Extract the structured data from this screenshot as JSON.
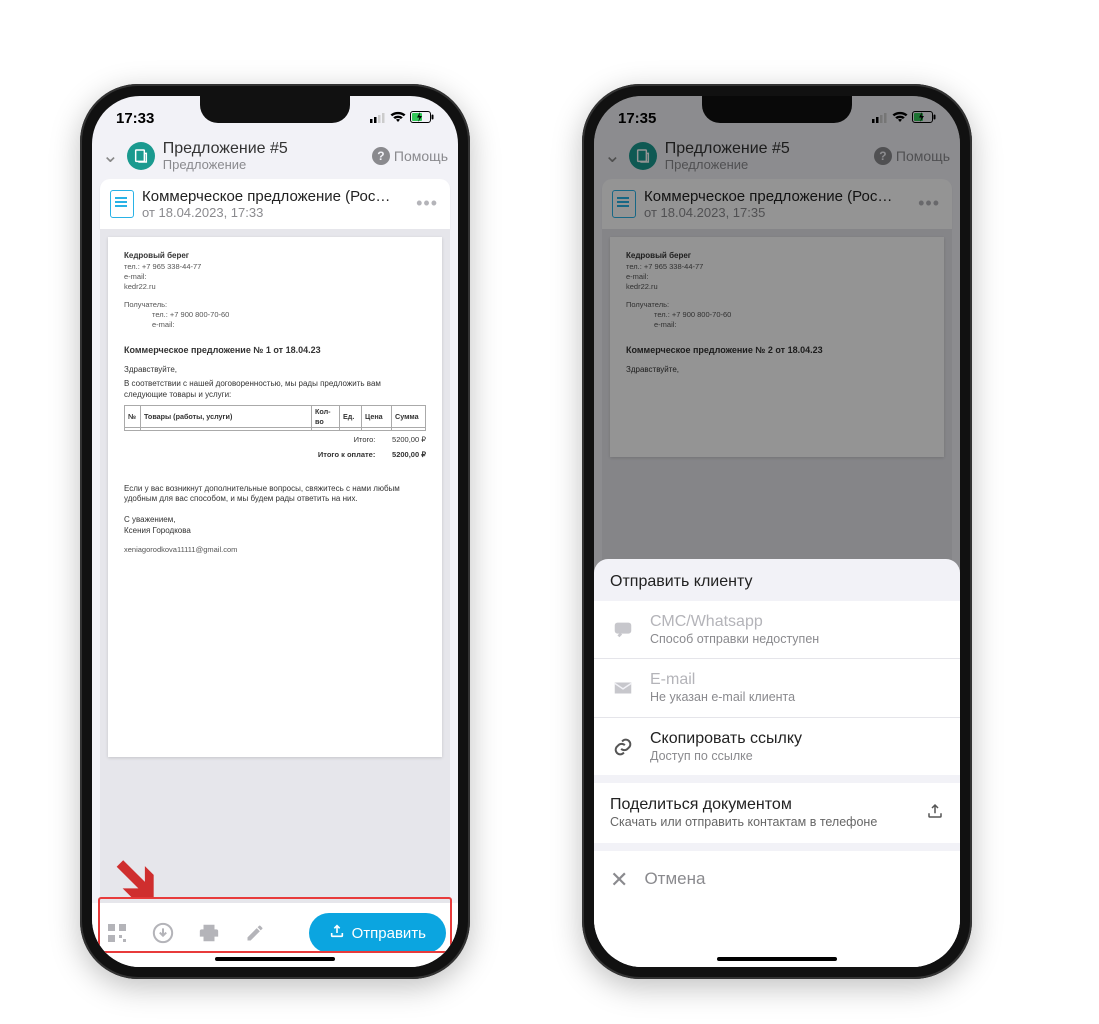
{
  "phoneLeft": {
    "status": {
      "time": "17:33"
    },
    "header": {
      "title": "Предложение #5",
      "subtitle": "Предложение",
      "help": "Помощь"
    },
    "docCard": {
      "title": "Коммерческое предложение (Рос…",
      "date": "от 18.04.2023, 17:33"
    },
    "paper": {
      "company": "Кедровый берег",
      "tel": "тел.: +7 965 338-44-77",
      "emailLabel": "e-mail:",
      "site": "kedr22.ru",
      "recipientLabel": "Получатель:",
      "recipientTel": "тел.: +7 900 800-70-60",
      "recipientEmail": "e-mail:",
      "title": "Коммерческое предложение № 1 от 18.04.23",
      "greeting": "Здравствуйте,",
      "intro": "В соответствии с нашей договоренностью, мы рады предложить вам следующие товары и услуги:",
      "table": {
        "headers": [
          "№",
          "Товары (работы, услуги)",
          "Кол-во",
          "Ед.",
          "Цена",
          "Сумма"
        ]
      },
      "totalLabel": "Итого:",
      "totalValue": "5200,00 ₽",
      "toPayLabel": "Итого к оплате:",
      "toPayValue": "5200,00 ₽",
      "outro": "Если у вас возникнут дополнительные вопросы, свяжитесь с нами любым удобным для вас способом, и мы будем рады ответить на них.",
      "regards": "С уважением,",
      "signName": "Ксения Городкова",
      "signEmail": "xeniagorodkova11111@gmail.com"
    },
    "bottomBar": {
      "send": "Отправить"
    }
  },
  "phoneRight": {
    "status": {
      "time": "17:35"
    },
    "header": {
      "title": "Предложение #5",
      "subtitle": "Предложение",
      "help": "Помощь"
    },
    "docCard": {
      "title": "Коммерческое предложение (Рос…",
      "date": "от 18.04.2023, 17:35"
    },
    "paper": {
      "company": "Кедровый берег",
      "tel": "тел.: +7 965 338-44-77",
      "emailLabel": "e-mail:",
      "site": "kedr22.ru",
      "recipientLabel": "Получатель:",
      "recipientTel": "тел.: +7 900 800-70-60",
      "recipientEmail": "e-mail:",
      "title": "Коммерческое предложение № 2 от 18.04.23",
      "greeting": "Здравствуйте,"
    },
    "sheet": {
      "header": "Отправить клиенту",
      "items": [
        {
          "title": "СМС/Whatsapp",
          "sub": "Способ отправки недоступен",
          "disabled": true
        },
        {
          "title": "E-mail",
          "sub": "Не указан e-mail клиента",
          "disabled": true
        },
        {
          "title": "Скопировать ссылку",
          "sub": "Доступ по ссылке",
          "disabled": false
        }
      ],
      "share": {
        "title": "Поделиться документом",
        "sub": "Скачать или отправить контактам в телефоне"
      },
      "cancel": "Отмена"
    }
  }
}
